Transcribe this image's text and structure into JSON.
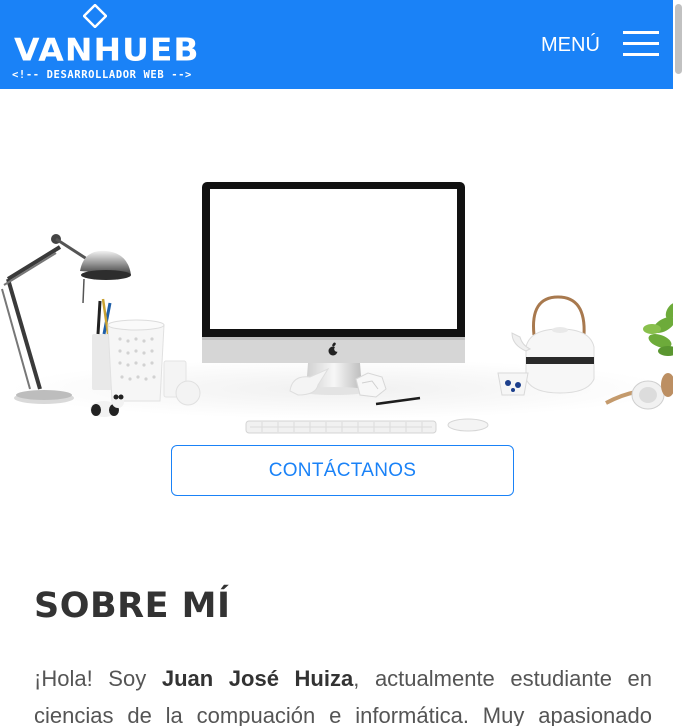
{
  "header": {
    "logo_word": "VANHUEB",
    "logo_tagline": "<!-- DESARROLLADOR WEB -->",
    "menu_label": "MENÚ",
    "background": "#1a82f7"
  },
  "hero": {
    "contact_label": "CONTÁCTANOS"
  },
  "about": {
    "title": "SOBRE MÍ",
    "intro": "¡Hola! Soy ",
    "name": "Juan José Huiza",
    "line1_rest": ", actualmente estudiante en",
    "line2": "ciencias de la compuación e informática. Muy apasionado"
  },
  "icons": {
    "logo": "diamond-logo-icon",
    "menu": "hamburger-menu-icon",
    "apple": "apple-logo-icon"
  },
  "colors": {
    "accent": "#1a82f7",
    "title": "#333333",
    "text": "#555555"
  }
}
